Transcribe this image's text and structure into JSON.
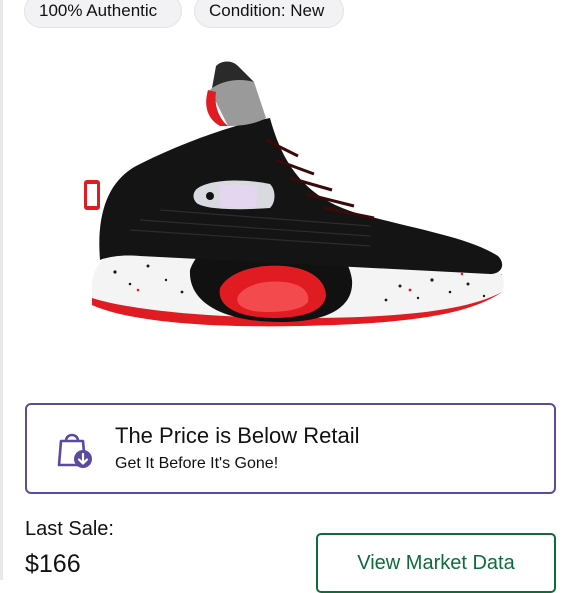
{
  "badges": {
    "authentic": "100% Authentic",
    "condition": "Condition: New"
  },
  "product_image": {
    "description_icon": "sneaker-image",
    "colors": {
      "upper": "#141414",
      "sole_red": "#e11b22",
      "midsole_white": "#f4f4f4",
      "collar_gray": "#9a9a9a"
    }
  },
  "price_banner": {
    "icon": "shopping-bag-download-icon",
    "title": "The Price is Below Retail",
    "subtitle": "Get It Before It's Gone!",
    "accent_color": "#5c4a9e"
  },
  "last_sale": {
    "label": "Last Sale:",
    "price": "$166"
  },
  "market_button": {
    "label": "View Market Data",
    "color": "#0f6b3a"
  }
}
